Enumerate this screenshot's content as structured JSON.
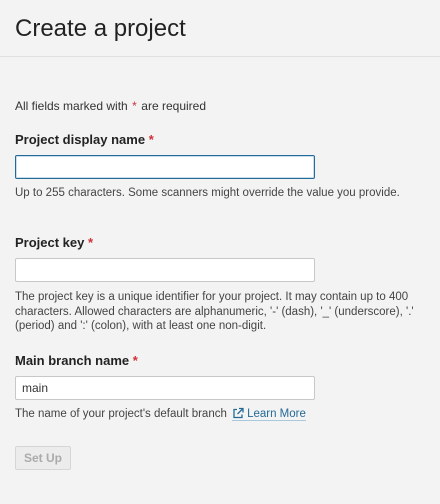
{
  "page": {
    "title": "Create a project"
  },
  "form": {
    "required_note_prefix": "All fields marked with",
    "required_star": "*",
    "required_note_suffix": "are required",
    "fields": {
      "display_name": {
        "label": "Project display name",
        "value": "",
        "placeholder": "",
        "help": "Up to 255 characters. Some scanners might override the value you provide."
      },
      "project_key": {
        "label": "Project key",
        "value": "",
        "placeholder": "",
        "help": "The project key is a unique identifier for your project. It may contain up to 400 characters. Allowed characters are alphanumeric, '-' (dash), '_' (underscore), '.' (period) and ':' (colon), with at least one non-digit."
      },
      "main_branch": {
        "label": "Main branch name",
        "value": "main",
        "placeholder": "",
        "help": "The name of your project's default branch",
        "link_label": "Learn More",
        "link_icon": "external-link-icon"
      }
    },
    "submit_label": "Set Up"
  },
  "colors": {
    "required_star": "#d02f3a",
    "link": "#236a97",
    "focus_border": "#236a97",
    "page_bg": "#f3f3f3"
  }
}
